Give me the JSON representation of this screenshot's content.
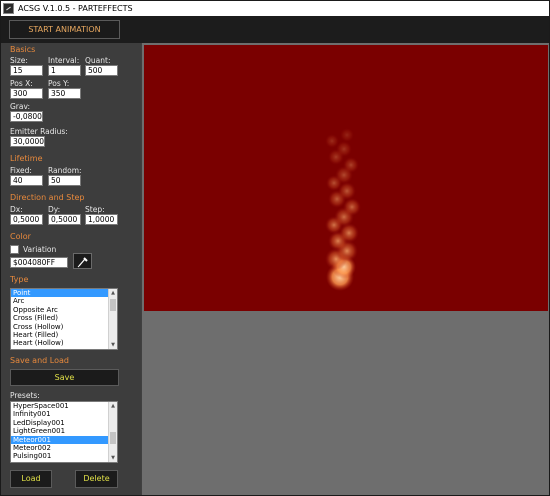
{
  "window": {
    "title": "ACSG V.1.0.5 - PARTEFFECTS"
  },
  "toolbar": {
    "start_label": "START ANIMATION"
  },
  "basics": {
    "heading": "Basics",
    "size_label": "Size:",
    "size_value": "15",
    "interval_label": "Interval:",
    "interval_value": "1",
    "quant_label": "Quant:",
    "quant_value": "500",
    "posx_label": "Pos X:",
    "posx_value": "300",
    "posy_label": "Pos Y:",
    "posy_value": "350",
    "grav_label": "Grav:",
    "grav_value": "-0,0800",
    "radius_label": "Emitter Radius:",
    "radius_value": "30,0000"
  },
  "lifetime": {
    "heading": "Lifetime",
    "fixed_label": "Fixed:",
    "fixed_value": "40",
    "random_label": "Random:",
    "random_value": "50"
  },
  "direction": {
    "heading": "Direction and Step",
    "dx_label": "Dx:",
    "dx_value": "0,5000",
    "dy_label": "Dy:",
    "dy_value": "0,5000",
    "step_label": "Step:",
    "step_value": "1,0000"
  },
  "color": {
    "heading": "Color",
    "variation_label": "Variation",
    "variation_checked": false,
    "value": "$004080FF"
  },
  "type": {
    "heading": "Type",
    "items": [
      "Point",
      "Arc",
      "Opposite Arc",
      "Cross (Filled)",
      "Cross (Hollow)",
      "Heart (Filled)",
      "Heart (Hollow)"
    ],
    "selected": "Point"
  },
  "save_load": {
    "heading": "Save and Load",
    "save_label": "Save",
    "presets_label": "Presets:",
    "presets": [
      "HyperSpace001",
      "Infinity001",
      "LedDisplay001",
      "LightGreen001",
      "Meteor001",
      "Meteor002",
      "Pulsing001"
    ],
    "selected": "Meteor001",
    "load_label": "Load",
    "delete_label": "Delete"
  },
  "colors": {
    "canvas_bg": "#7a0000",
    "particle": "#ff9a50",
    "accent": "#e8893c",
    "button_text": "#e0e048"
  }
}
